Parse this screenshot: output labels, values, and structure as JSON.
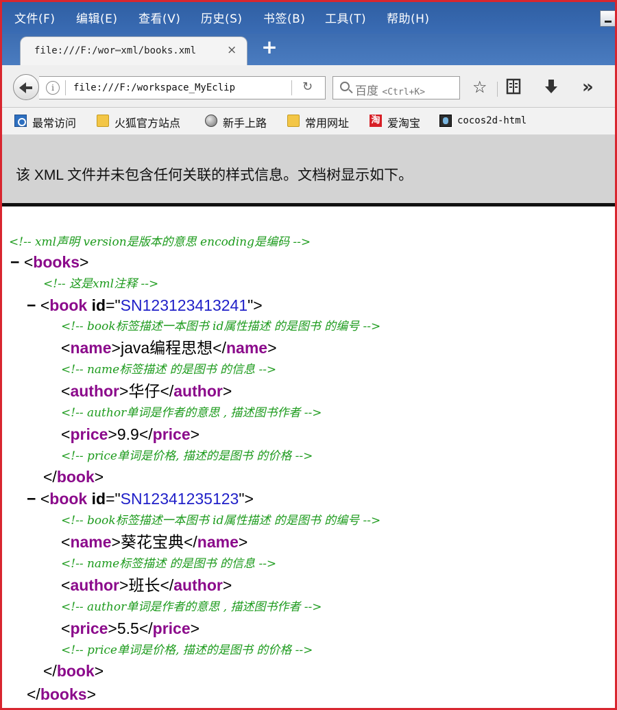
{
  "menu": [
    "文件(F)",
    "编辑(E)",
    "查看(V)",
    "历史(S)",
    "书签(B)",
    "工具(T)",
    "帮助(H)"
  ],
  "tab": {
    "title": "file:///F:/wor⋯xml/books.xml",
    "close": "×",
    "new_tab": "+"
  },
  "nav": {
    "url": "file:///F:/workspace_MyEclip",
    "search_engine": "百度",
    "search_shortcut": "<Ctrl+K>",
    "icons": [
      "back-icon",
      "info-icon",
      "reload-icon",
      "search-icon",
      "star-icon",
      "reading-list-icon",
      "download-icon",
      "overflow-icon"
    ]
  },
  "bookmarks": [
    {
      "label": "最常访问",
      "icon": "most-visited-icon"
    },
    {
      "label": "火狐官方站点",
      "icon": "folder-icon"
    },
    {
      "label": "新手上路",
      "icon": "globe-icon"
    },
    {
      "label": "常用网址",
      "icon": "folder-icon"
    },
    {
      "label": "爱淘宝",
      "icon": "taobao-icon",
      "icon_text": "淘"
    },
    {
      "label": "cocos2d-html",
      "icon": "cocos-icon"
    }
  ],
  "banner": "该 XML 文件并未包含任何关联的样式信息。文档树显示如下。",
  "xml": {
    "comment_decl": "<!-- xml声明 version是版本的意思   encoding是编码  -->",
    "root_tag": "books",
    "comment_root": "<!-- 这是xml注释 -->",
    "toggle": "−",
    "attr_name": "id",
    "books": [
      {
        "id": "SN123123413241",
        "comment_book": "<!-- book标签描述一本图书   id属性描述 的是图书 的编号  -->",
        "name": "java编程思想",
        "comment_name": "<!-- name标签描述 的是图书 的信息 -->",
        "author": "华仔",
        "comment_author": "<!-- author单词是作者的意思 , 描述图书作者 -->",
        "price": "9.9",
        "comment_price": "<!-- price单词是价格, 描述的是图书 的价格 -->"
      },
      {
        "id": "SN12341235123",
        "comment_book": "<!-- book标签描述一本图书   id属性描述 的是图书 的编号  -->",
        "name": "葵花宝典",
        "comment_name": "<!-- name标签描述 的是图书 的信息 -->",
        "author": "班长",
        "comment_author": "<!-- author单词是作者的意思 , 描述图书作者 -->",
        "price": "5.5",
        "comment_price": "<!-- price单词是价格, 描述的是图书 的价格 -->"
      }
    ],
    "child_tags": {
      "book": "book",
      "name": "name",
      "author": "author",
      "price": "price"
    }
  }
}
